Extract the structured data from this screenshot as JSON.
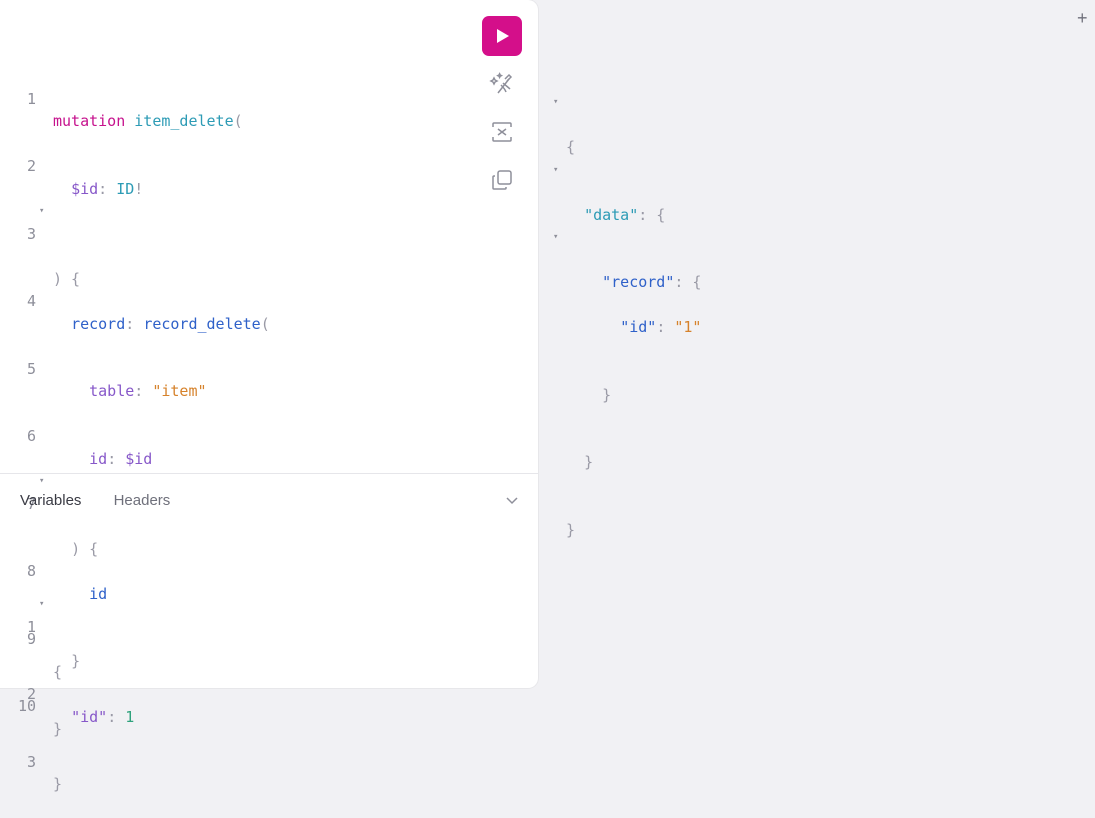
{
  "query": {
    "lines": [
      {
        "n": "1",
        "fold": ""
      },
      {
        "n": "2",
        "fold": ""
      },
      {
        "n": "3",
        "fold": "▾"
      },
      {
        "n": "4",
        "fold": ""
      },
      {
        "n": "5",
        "fold": ""
      },
      {
        "n": "6",
        "fold": ""
      },
      {
        "n": "7",
        "fold": "▾"
      },
      {
        "n": "8",
        "fold": ""
      },
      {
        "n": "9",
        "fold": ""
      },
      {
        "n": "10",
        "fold": ""
      }
    ],
    "keyword": "mutation",
    "op_name": "item_delete",
    "var_name": "$id",
    "var_type": "ID",
    "alias": "record",
    "field": "record_delete",
    "arg_table": "table",
    "arg_table_value": "\"item\"",
    "arg_id": "id",
    "arg_id_value": "$id",
    "selection": "id"
  },
  "toolbar": {
    "run_icon": "play-icon",
    "prettify_icon": "magic-wand-icon",
    "merge_icon": "merge-fragments-icon",
    "copy_icon": "copy-icon"
  },
  "bottom_tabs": {
    "variables": "Variables",
    "headers": "Headers"
  },
  "variables": {
    "lines": [
      {
        "n": "1",
        "fold": "▾"
      },
      {
        "n": "2",
        "fold": ""
      },
      {
        "n": "3",
        "fold": ""
      }
    ],
    "key": "\"id\"",
    "value": "1"
  },
  "result": {
    "key_data": "\"data\"",
    "key_record": "\"record\"",
    "key_id": "\"id\"",
    "value_id": "\"1\""
  },
  "add_tab": "+",
  "colors": {
    "accent": "#d40f8a",
    "background": "#f1f1f4"
  }
}
